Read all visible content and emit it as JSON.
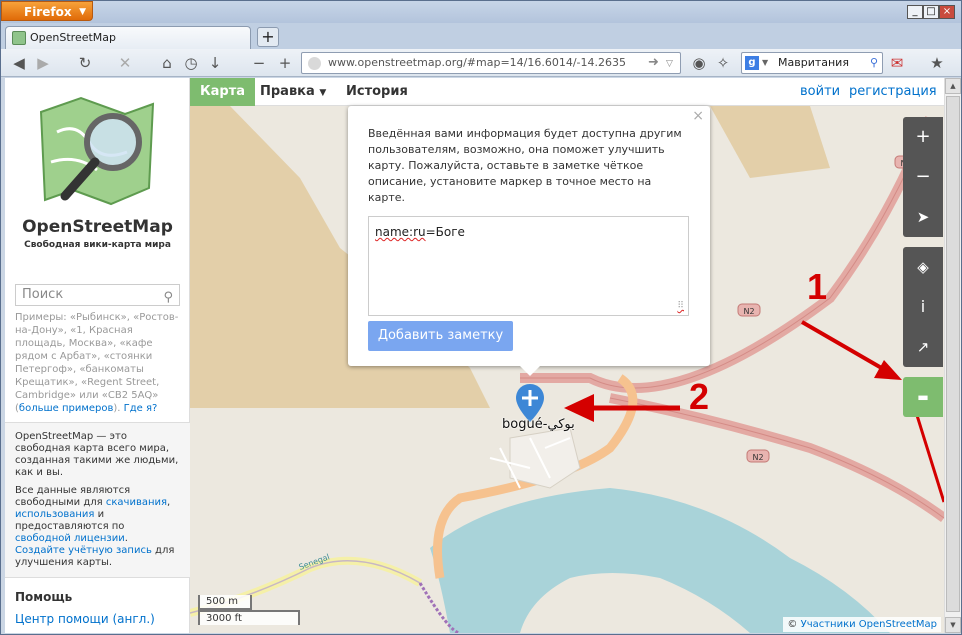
{
  "browser": {
    "app_button": "Firefox",
    "tab_title": "OpenStreetMap",
    "url": "www.openstreetmap.org/#map=14/16.6014/-14.2635",
    "search_value": "Мавритания",
    "search_engine_icon": "google-icon"
  },
  "osm": {
    "brand": "OpenStreetMap",
    "tagline": "Свободная вики-карта мира",
    "search_placeholder": "Поиск",
    "examples_text": "Примеры: «Рыбинск», «Ростов-на-Дону», «1, Красная площадь, Москва», «кафе рядом с Арбат», «стоянки Петергоф», «банкоматы Крещатик», «Regent Street, Cambridge» или «CB2 5AQ»",
    "examples_more": "больше примеров",
    "examples_where": "Где я?",
    "about_p1": "OpenStreetMap — это свободная карта всего мира, созданная такими же людьми, как и вы.",
    "about_p2_a": "Все данные являются свободными для ",
    "about_link_download": "скачивания",
    "about_link_use": "использования",
    "about_p2_b": " и предоставляются по ",
    "about_link_license": "свободной лицензии",
    "about_p2_c": ". ",
    "about_link_signup": "Создайте учётную запись",
    "about_p2_d": " для улучшения карты.",
    "help_title": "Помощь",
    "help_link": "Центр помощи (англ.)"
  },
  "nav": {
    "tab_map": "Карта",
    "tab_edit": "Правка",
    "tab_history": "История",
    "login": "войти",
    "signup": "регистрация"
  },
  "note_popup": {
    "message": "Введённая вами информация будет доступна другим пользователям, возможно, она поможет улучшить карту. Пожалуйста, оставьте в заметке чёткое описание, установите маркер в точное место на карте.",
    "note_key": "name:ru",
    "note_value": "=Боге",
    "add_button": "Добавить заметку",
    "close": "×"
  },
  "map": {
    "place_label": "bogué-بوكي",
    "road_shield": "N2",
    "river_label": "Senegal",
    "scale_metric": "500 m",
    "scale_imperial": "3000 ft",
    "attribution_prefix": "© ",
    "attribution_link": "Участники OpenStreetMap"
  },
  "annotations": {
    "label_1": "1",
    "label_2": "2",
    "color": "#d40000"
  },
  "colors": {
    "osm_green": "#7ebc6f",
    "link_blue": "#0071cc",
    "control_dark": "#555555"
  }
}
